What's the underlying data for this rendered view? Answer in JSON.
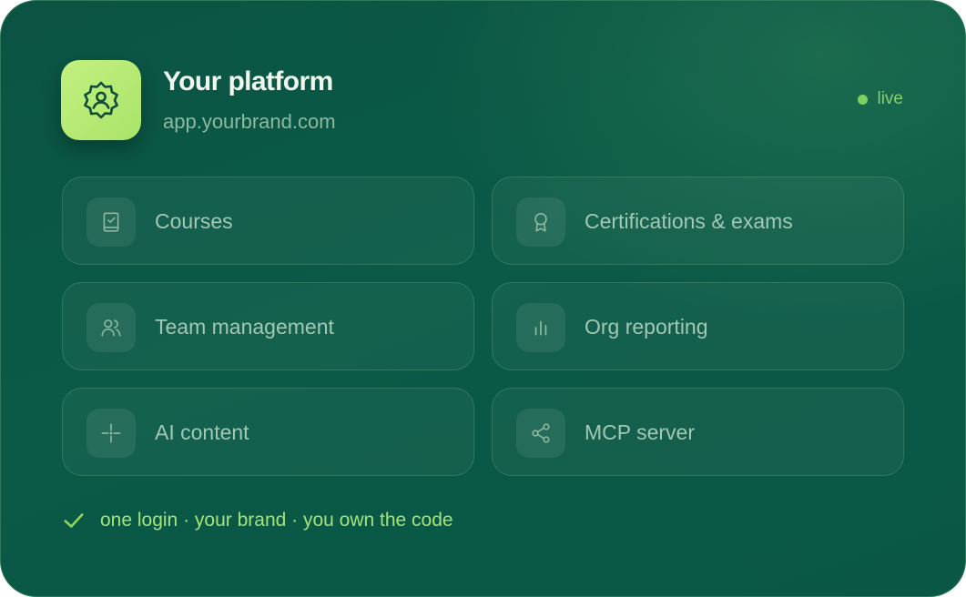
{
  "header": {
    "title": "Your platform",
    "domain": "app.yourbrand.com",
    "app_icon": "badge-user-icon",
    "status": {
      "label": "live",
      "icon": "status-dot-icon",
      "color": "#7ed061"
    }
  },
  "tiles": [
    {
      "label": "Courses",
      "icon": "book-check-icon"
    },
    {
      "label": "Certifications & exams",
      "icon": "award-icon"
    },
    {
      "label": "Team management",
      "icon": "users-icon"
    },
    {
      "label": "Org reporting",
      "icon": "bar-chart-icon"
    },
    {
      "label": "AI content",
      "icon": "sparkle-icon"
    },
    {
      "label": "MCP server",
      "icon": "share-icon"
    }
  ],
  "footer": {
    "text": "one login · your brand · you own the code",
    "icon": "check-icon"
  },
  "colors": {
    "background": "#0a5745",
    "accent": "#a8e46a",
    "tile_text": "#a2c8b5",
    "footer_text": "#a6e27a"
  }
}
